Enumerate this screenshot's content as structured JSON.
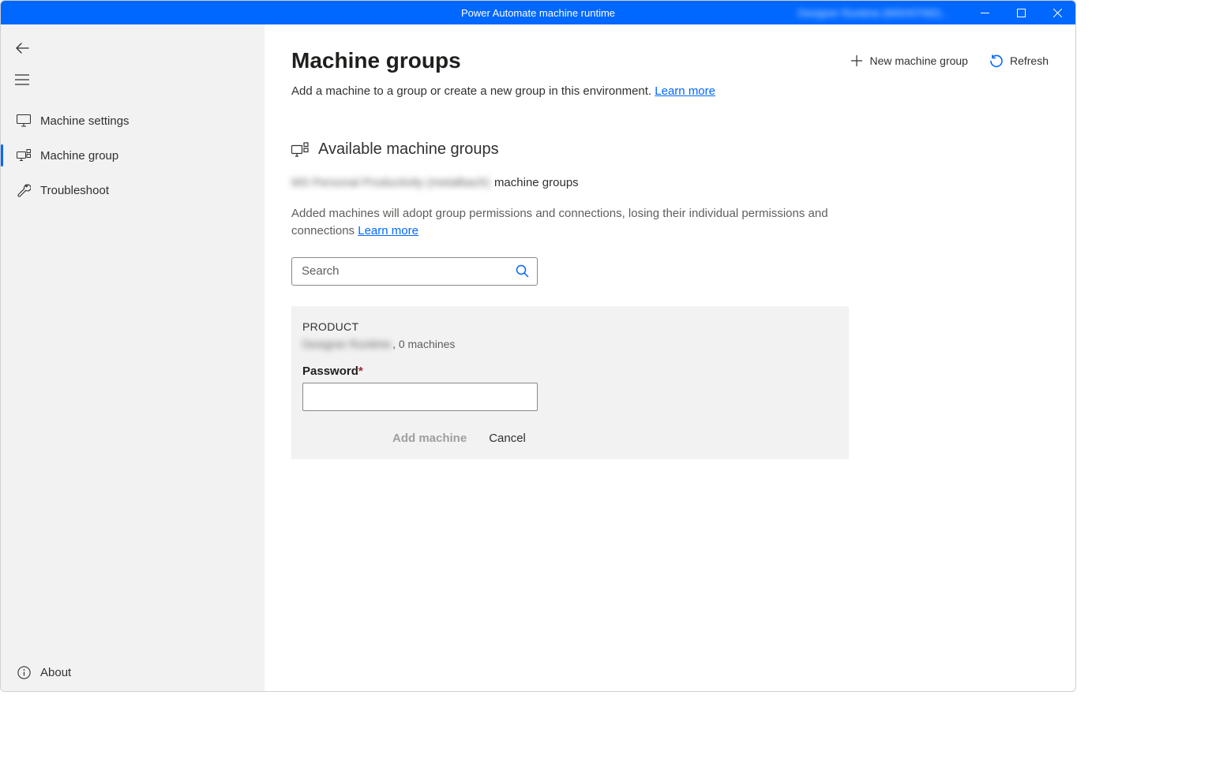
{
  "titlebar": {
    "title": "Power Automate machine runtime",
    "user_blur": "Designer Runtime (MSHSTND)..."
  },
  "sidebar": {
    "items": [
      {
        "label": "Machine settings"
      },
      {
        "label": "Machine group"
      },
      {
        "label": "Troubleshoot"
      }
    ],
    "about": "About"
  },
  "header": {
    "title": "Machine groups",
    "new_group": "New machine group",
    "refresh": "Refresh"
  },
  "subtitle": {
    "text": "Add a machine to a group or create a new group in this environment. ",
    "link": "Learn more"
  },
  "section": {
    "heading": "Available machine groups",
    "env_blur": "MS Personal Productivity (metalbach)",
    "env_suffix": "machine groups",
    "info_text": "Added machines will adopt group permissions and connections, losing their individual permissions and connections ",
    "info_link": "Learn more"
  },
  "search": {
    "placeholder": "Search"
  },
  "card": {
    "product": "PRODUCT",
    "owner_blur": "Designer Runtime",
    "owner_suffix": ", 0 machines",
    "password_label": "Password",
    "required": "*",
    "add_btn": "Add machine",
    "cancel_btn": "Cancel"
  }
}
